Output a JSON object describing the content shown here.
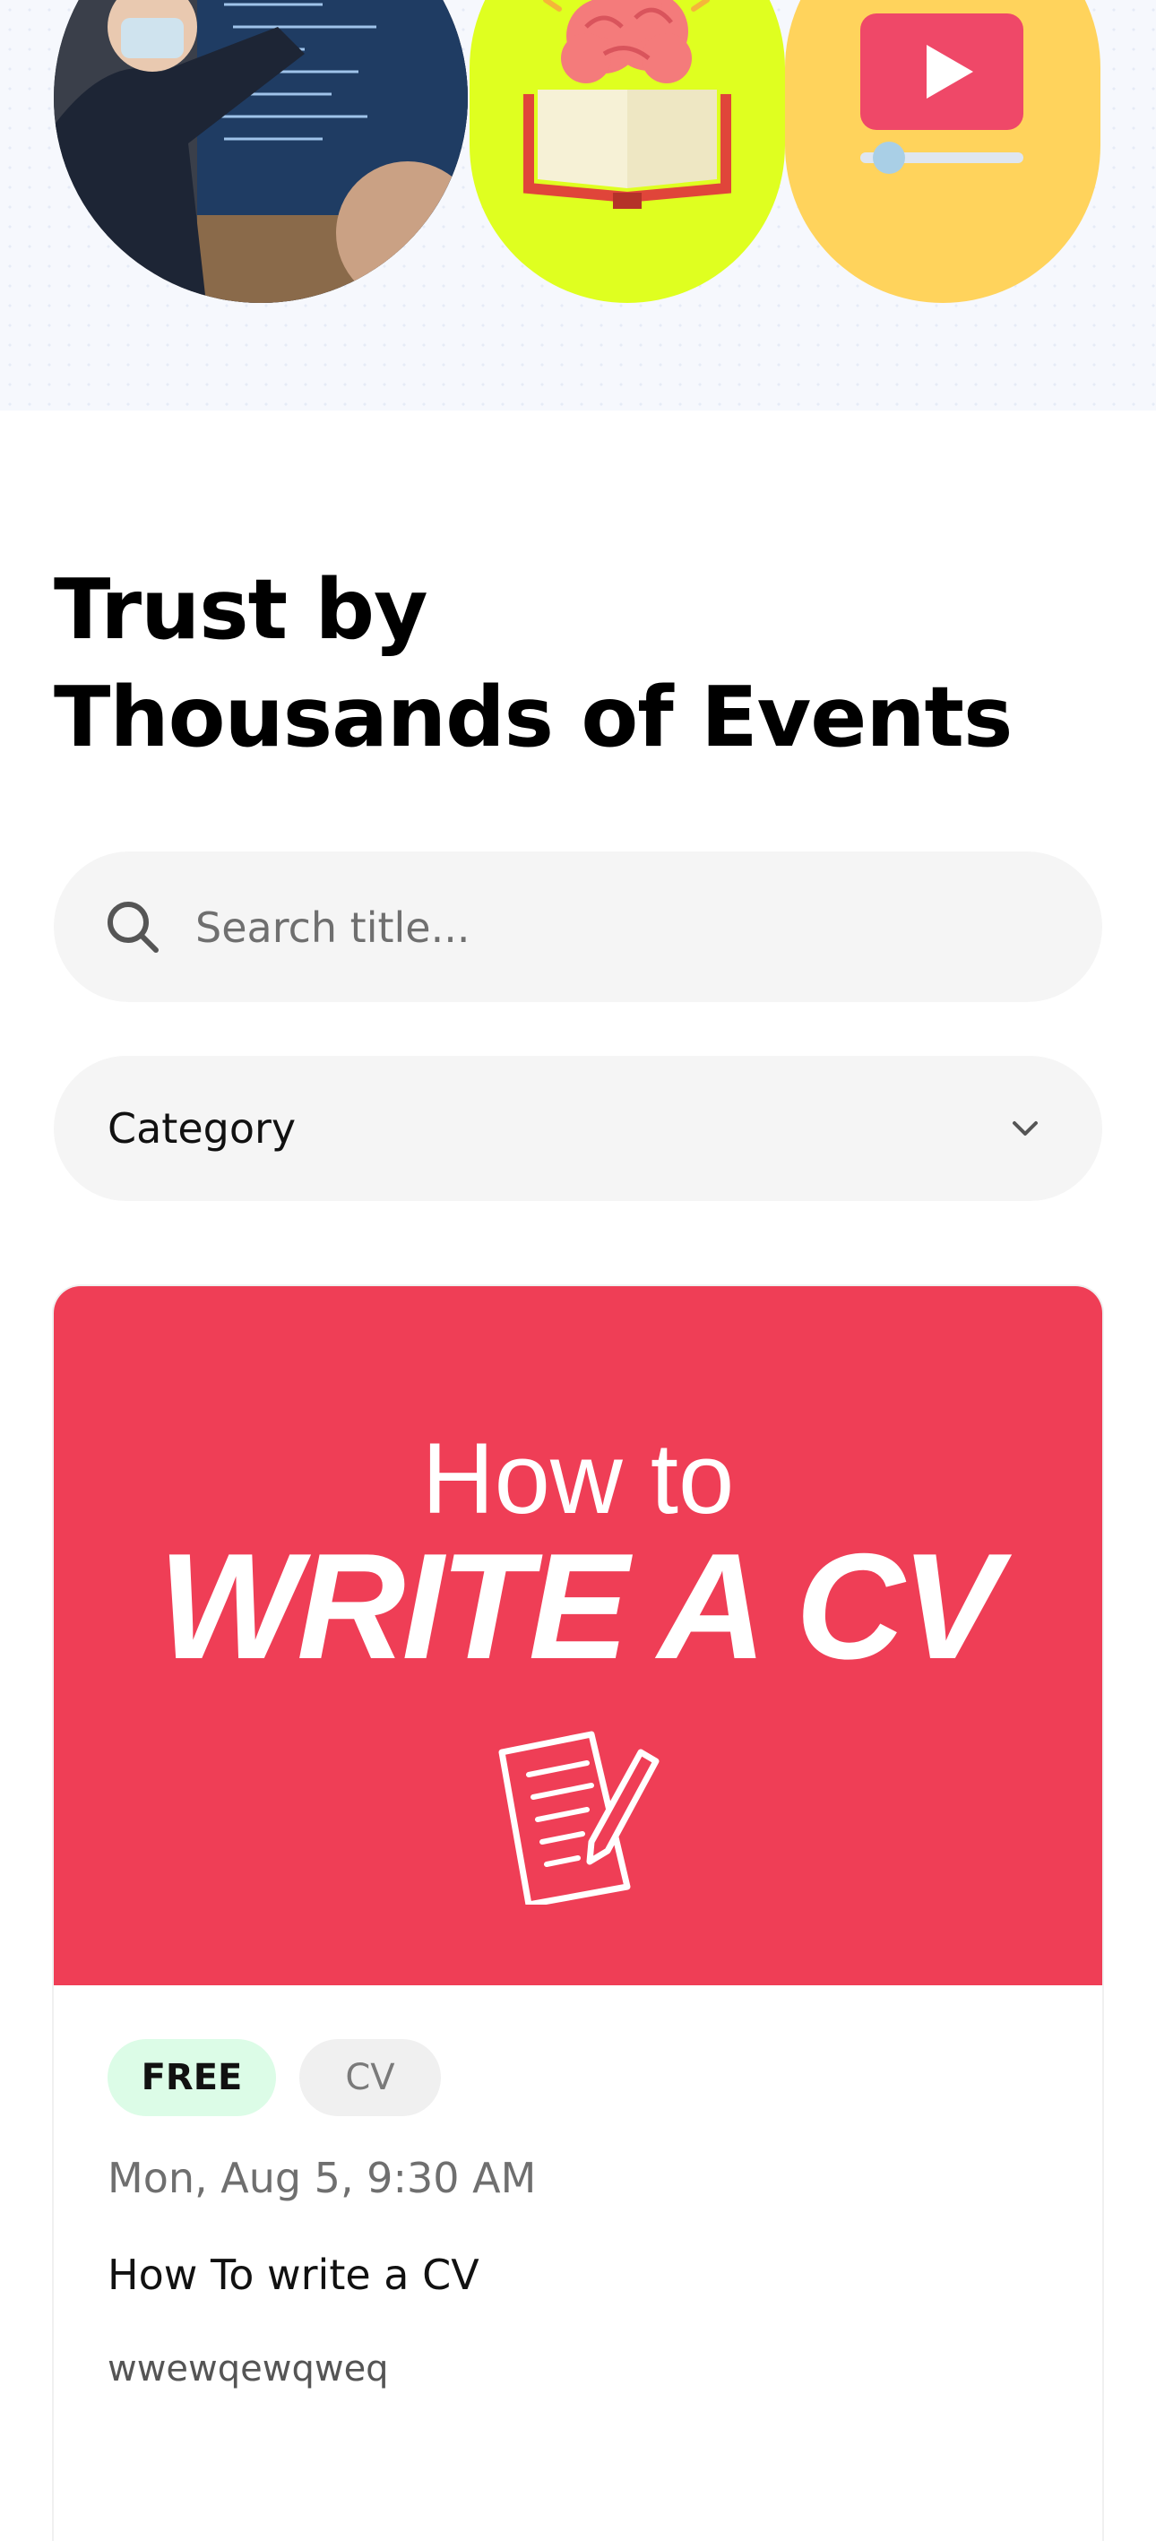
{
  "hero": {
    "images": [
      {
        "name": "presenter-photo"
      },
      {
        "name": "brain-book-icon"
      },
      {
        "name": "video-player-icon"
      }
    ]
  },
  "section": {
    "heading_line1": "Trust by",
    "heading_line2": "Thousands of Events"
  },
  "search": {
    "placeholder": "Search title...",
    "value": "",
    "icon": "search-icon"
  },
  "category": {
    "selected": "Category",
    "icon": "chevron-down-icon"
  },
  "event": {
    "banner_line1": "How to",
    "banner_line2": "WRITE A CV",
    "banner_icon": "document-pencil-icon",
    "tags": [
      "FREE",
      "CV"
    ],
    "date": "Mon, Aug 5, 9:30 AM",
    "title": "How To write a CV",
    "description": "wwewqewqweq"
  },
  "colors": {
    "banner_red": "#ef3e56",
    "free_badge_bg": "#dcfce7",
    "hero_green": "#dfff20",
    "hero_yellow": "#ffd35c",
    "field_bg": "#f5f5f5"
  }
}
